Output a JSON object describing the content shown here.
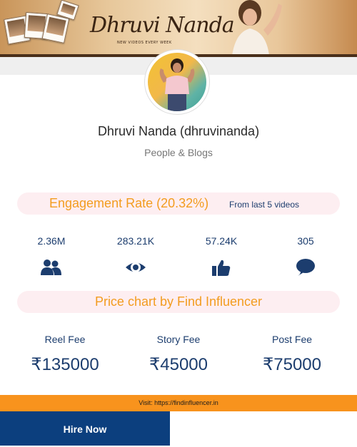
{
  "banner": {
    "title": "Dhruvi Nanda",
    "subtitle": "NEW VIDEOS EVERY WEEK"
  },
  "profile": {
    "name": "Dhruvi Nanda (dhruvinanda)",
    "category": "People & Blogs"
  },
  "engagement": {
    "title": "Engagement Rate (20.32%)",
    "subtitle": "From last 5 videos"
  },
  "stats": [
    {
      "value": "2.36M",
      "icon": "users-icon"
    },
    {
      "value": "283.21K",
      "icon": "eye-icon"
    },
    {
      "value": "57.24K",
      "icon": "thumbs-up-icon"
    },
    {
      "value": "305",
      "icon": "comment-icon"
    }
  ],
  "price_chart": {
    "title": "Price chart by Find Influencer",
    "fees": [
      {
        "label": "Reel Fee",
        "value": "₹135000"
      },
      {
        "label": "Story Fee",
        "value": "₹45000"
      },
      {
        "label": "Post Fee",
        "value": "₹75000"
      }
    ]
  },
  "footer": {
    "visit_text": "Visit: https://findinfluencer.in"
  },
  "actions": {
    "hire_label": "Hire Now"
  },
  "colors": {
    "accent_orange": "#f39c1f",
    "navy": "#1c3d6e",
    "footer_orange": "#f8931d",
    "hire_blue": "#0c3f7e",
    "pill_pink": "#fdeef1"
  }
}
